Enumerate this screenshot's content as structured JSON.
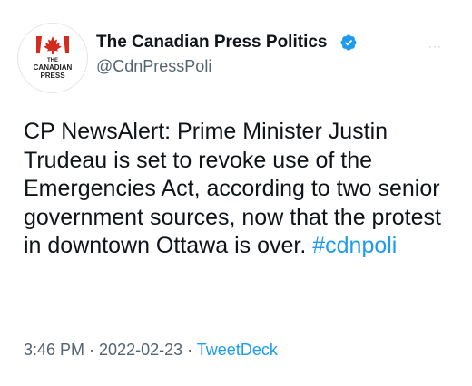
{
  "account": {
    "name": "The Canadian Press Politics",
    "handle": "@CdnPressPoli",
    "avatar_logo": {
      "line1": "THE",
      "line2": "CANADIAN",
      "line3": "PRESS",
      "accent_color": "#d52b1e"
    },
    "verified_icon": "verified-badge-icon",
    "verified_color": "#1d9bf0"
  },
  "more_menu": {
    "icon": "more-options-icon",
    "label": "···"
  },
  "tweet": {
    "text": "CP NewsAlert: Prime Minister Justin Trudeau is set to revoke use of the Emergencies Act, according to two senior government sources, now that the protest in downtown Ottawa is over.",
    "hashtag": "#cdnpoli"
  },
  "meta": {
    "time": "3:46 PM",
    "separator1": " · ",
    "date": "2022-02-23",
    "separator2": " · ",
    "source": "TweetDeck"
  },
  "colors": {
    "text": "#0f1419",
    "secondary": "#536471",
    "link": "#1d9bf0"
  }
}
